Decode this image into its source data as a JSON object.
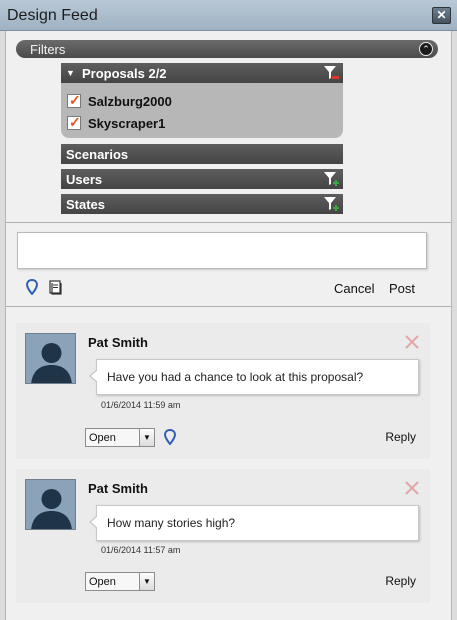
{
  "window": {
    "title": "Design Feed",
    "close_label": "✕"
  },
  "filters": {
    "title": "Filters",
    "groups": {
      "proposals": {
        "label": "Proposals 2/2",
        "items": [
          "Salzburg2000",
          "Skyscraper1"
        ]
      },
      "scenarios": {
        "label": "Scenarios"
      },
      "users": {
        "label": "Users"
      },
      "states": {
        "label": "States"
      }
    }
  },
  "composer": {
    "input_value": "",
    "cancel_label": "Cancel",
    "post_label": "Post"
  },
  "posts": [
    {
      "author": "Pat Smith",
      "message": "Have you had a chance to look at this proposal?",
      "timestamp": "01/6/2014 11:59 am",
      "status": "Open",
      "reply_label": "Reply",
      "has_pin": true
    },
    {
      "author": "Pat Smith",
      "message": "How many stories high?",
      "timestamp": "01/6/2014 11:57 am",
      "status": "Open",
      "reply_label": "Reply",
      "has_pin": false
    }
  ],
  "colors": {
    "accent_check": "#e0561e",
    "pin_blue": "#2f5fb3",
    "title_bar": "#a9bccc"
  },
  "icons": [
    "close-icon",
    "collapse-icon",
    "filter-remove-icon",
    "filter-add-icon",
    "location-pin-icon",
    "book-icon",
    "delete-icon",
    "dropdown-arrow-icon",
    "avatar-icon"
  ]
}
